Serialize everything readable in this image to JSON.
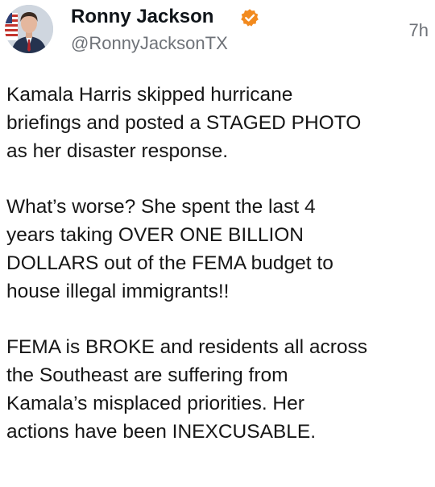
{
  "author": {
    "display_name": "Ronny Jackson",
    "handle": "@RonnyJacksonTX",
    "verified": true,
    "badge_color": "#f28a1e",
    "avatar_icon": "profile-photo-icon"
  },
  "post": {
    "timestamp": "7h",
    "paragraphs": [
      "Kamala Harris skipped hurricane\nbriefings and posted a STAGED PHOTO\nas her disaster response.",
      "What’s worse? She spent the last 4\nyears taking OVER ONE BILLION\nDOLLARS out of the FEMA budget to\nhouse illegal immigrants!!",
      "FEMA is BROKE and residents all across\nthe Southeast are suffering from\nKamala’s misplaced priorities. Her\nactions have been INEXCUSABLE."
    ]
  }
}
